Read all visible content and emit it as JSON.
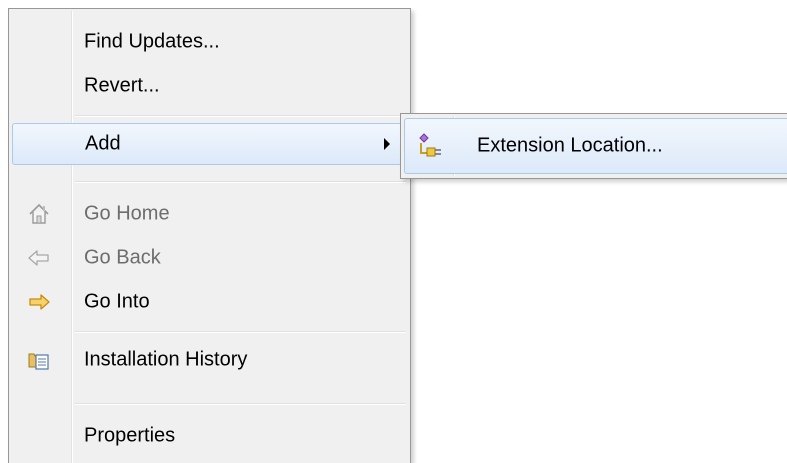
{
  "menu": {
    "items": [
      {
        "label": "Find Updates...",
        "enabled": true
      },
      {
        "label": "Revert...",
        "enabled": true
      },
      {
        "label": "Add",
        "enabled": true,
        "highlighted": true,
        "has_submenu": true
      },
      {
        "label": "Go Home",
        "enabled": false,
        "icon": "home-icon"
      },
      {
        "label": "Go Back",
        "enabled": false,
        "icon": "back-arrow-icon"
      },
      {
        "label": "Go Into",
        "enabled": true,
        "icon": "forward-arrow-icon"
      },
      {
        "label": "Installation History",
        "enabled": true,
        "icon": "history-icon"
      },
      {
        "label": "Properties",
        "enabled": true
      }
    ]
  },
  "submenu": {
    "items": [
      {
        "label": "Extension Location...",
        "icon": "plugin-extension-icon",
        "highlighted": true
      }
    ]
  },
  "colors": {
    "menu_bg": "#f0f0f0",
    "highlight_border": "#aac9ef",
    "disabled_text": "#6d6d6d",
    "go_into_arrow": "#f0b020"
  }
}
